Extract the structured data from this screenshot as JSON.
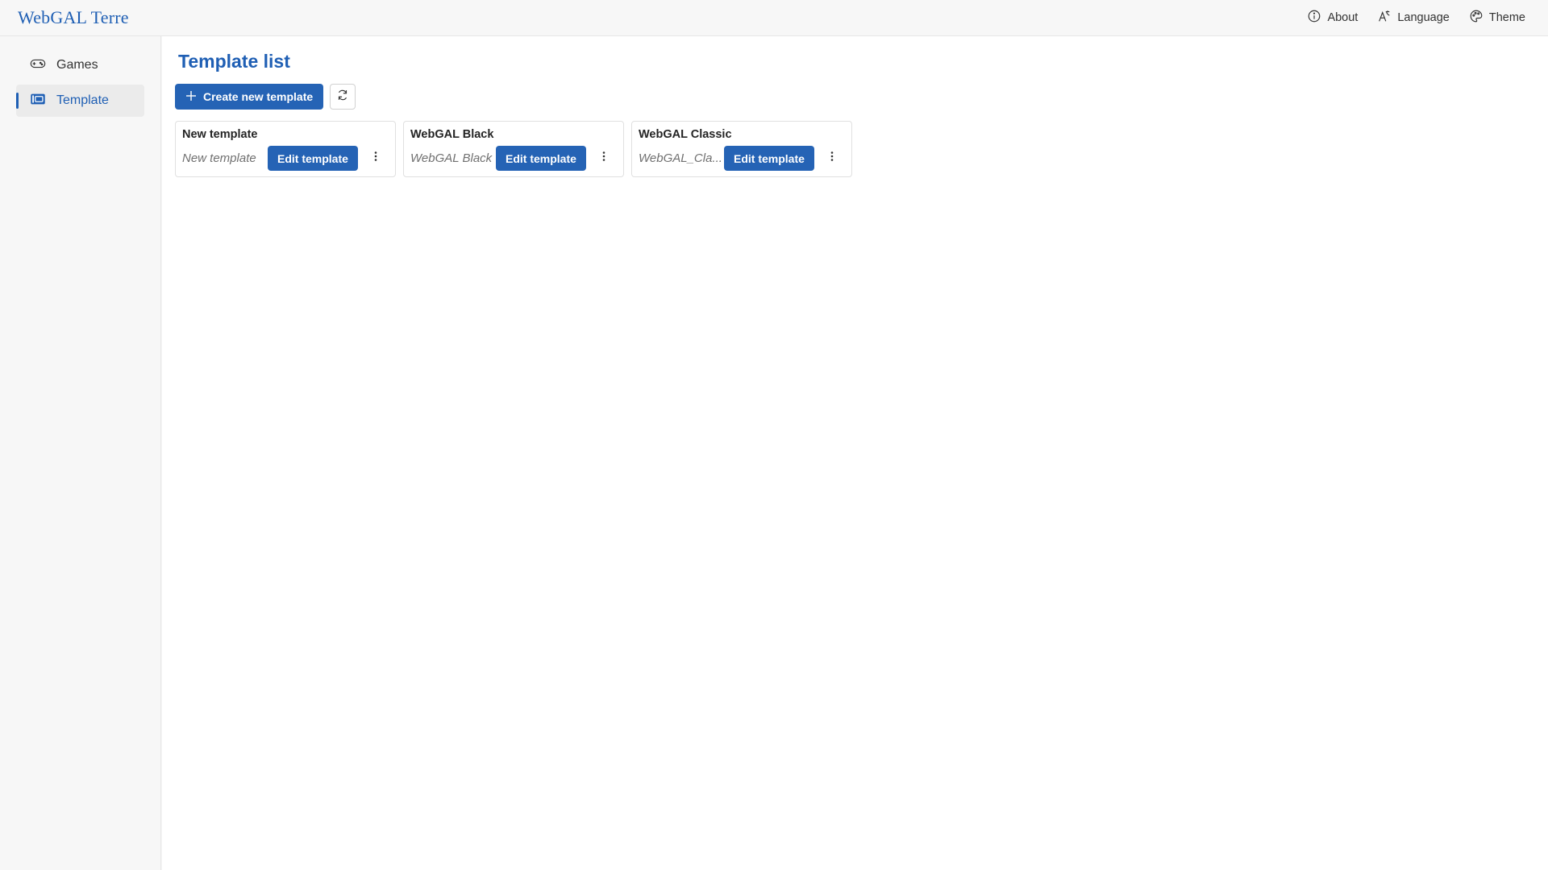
{
  "app": {
    "brand": "WebGAL Terre"
  },
  "header": {
    "about_label": "About",
    "language_label": "Language",
    "theme_label": "Theme"
  },
  "sidebar": {
    "items": [
      {
        "label": "Games",
        "icon": "gamepad-icon",
        "active": false
      },
      {
        "label": "Template",
        "icon": "template-icon",
        "active": true
      }
    ]
  },
  "main": {
    "title": "Template list",
    "create_label": "Create new template",
    "refresh_icon": "refresh-icon",
    "templates": [
      {
        "name": "New template",
        "dir": "New template",
        "edit_label": "Edit template"
      },
      {
        "name": "WebGAL Black",
        "dir": "WebGAL Black",
        "edit_label": "Edit template"
      },
      {
        "name": "WebGAL Classic",
        "dir": "WebGAL_Cla...",
        "edit_label": "Edit template"
      }
    ]
  },
  "colors": {
    "accent": "#1f5fb4",
    "button": "#2563b5",
    "background": "#f7f7f7"
  }
}
